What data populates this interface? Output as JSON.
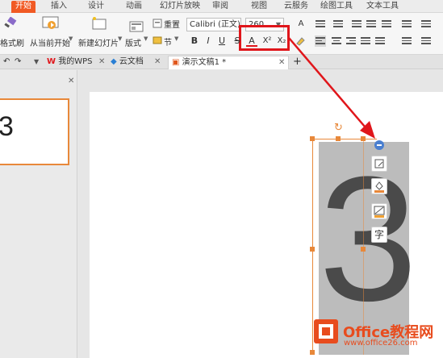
{
  "menu": {
    "items": [
      "开始",
      "插入",
      "设计",
      "动画",
      "幻灯片放映",
      "审阅",
      "视图",
      "云服务",
      "绘图工具",
      "文本工具"
    ]
  },
  "ribbon": {
    "format_brush": "格式刷",
    "from_current": "从当前开始",
    "new_slide": "新建幻灯片",
    "layout": "版式",
    "reset": "重置",
    "section": "节",
    "font_name": "Calibri (正文)",
    "font_size": "260",
    "bold": "B",
    "italic": "I",
    "underline": "U",
    "strike": "S",
    "font_color": "A",
    "superscript": "X²",
    "subscript": "X₂"
  },
  "tabs": {
    "wps": "我的WPS",
    "cloud": "云文档",
    "doc": "演示文稿1 *",
    "add": "+"
  },
  "thumbnail": {
    "number": "3"
  },
  "slide": {
    "text": "3"
  },
  "watermark": {
    "brand": "Office教程网",
    "url": "www.office26.com"
  },
  "colors": {
    "accent": "#f15a24",
    "highlight": "#e0161b",
    "selection": "#e8883a"
  }
}
